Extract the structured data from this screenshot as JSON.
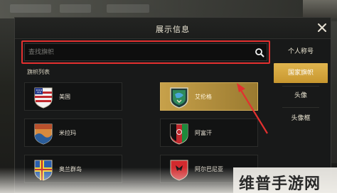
{
  "dialog": {
    "title": "展示信息",
    "search_placeholder": "查找旗帜"
  },
  "section_label": "旗帜列表",
  "flags": [
    {
      "name": "美国",
      "icon": "usa-flag-icon",
      "selected": false
    },
    {
      "name": "艾伦格",
      "icon": "erangel-flag-icon",
      "selected": true
    },
    {
      "name": "米拉玛",
      "icon": "miramar-flag-icon",
      "selected": false
    },
    {
      "name": "阿富汗",
      "icon": "afghanistan-flag-icon",
      "selected": false
    },
    {
      "name": "奥兰群岛",
      "icon": "aland-flag-icon",
      "selected": false
    },
    {
      "name": "阿尔巴尼亚",
      "icon": "albania-flag-icon",
      "selected": false
    }
  ],
  "tabs": [
    {
      "label": "个人称号",
      "active": false
    },
    {
      "label": "国家旗帜",
      "active": true
    },
    {
      "label": "头像",
      "active": false
    },
    {
      "label": "头像框",
      "active": false
    }
  ],
  "watermark": "维普手游网",
  "colors": {
    "accent": "#d4a540",
    "highlight_outline": "#e3302f"
  }
}
